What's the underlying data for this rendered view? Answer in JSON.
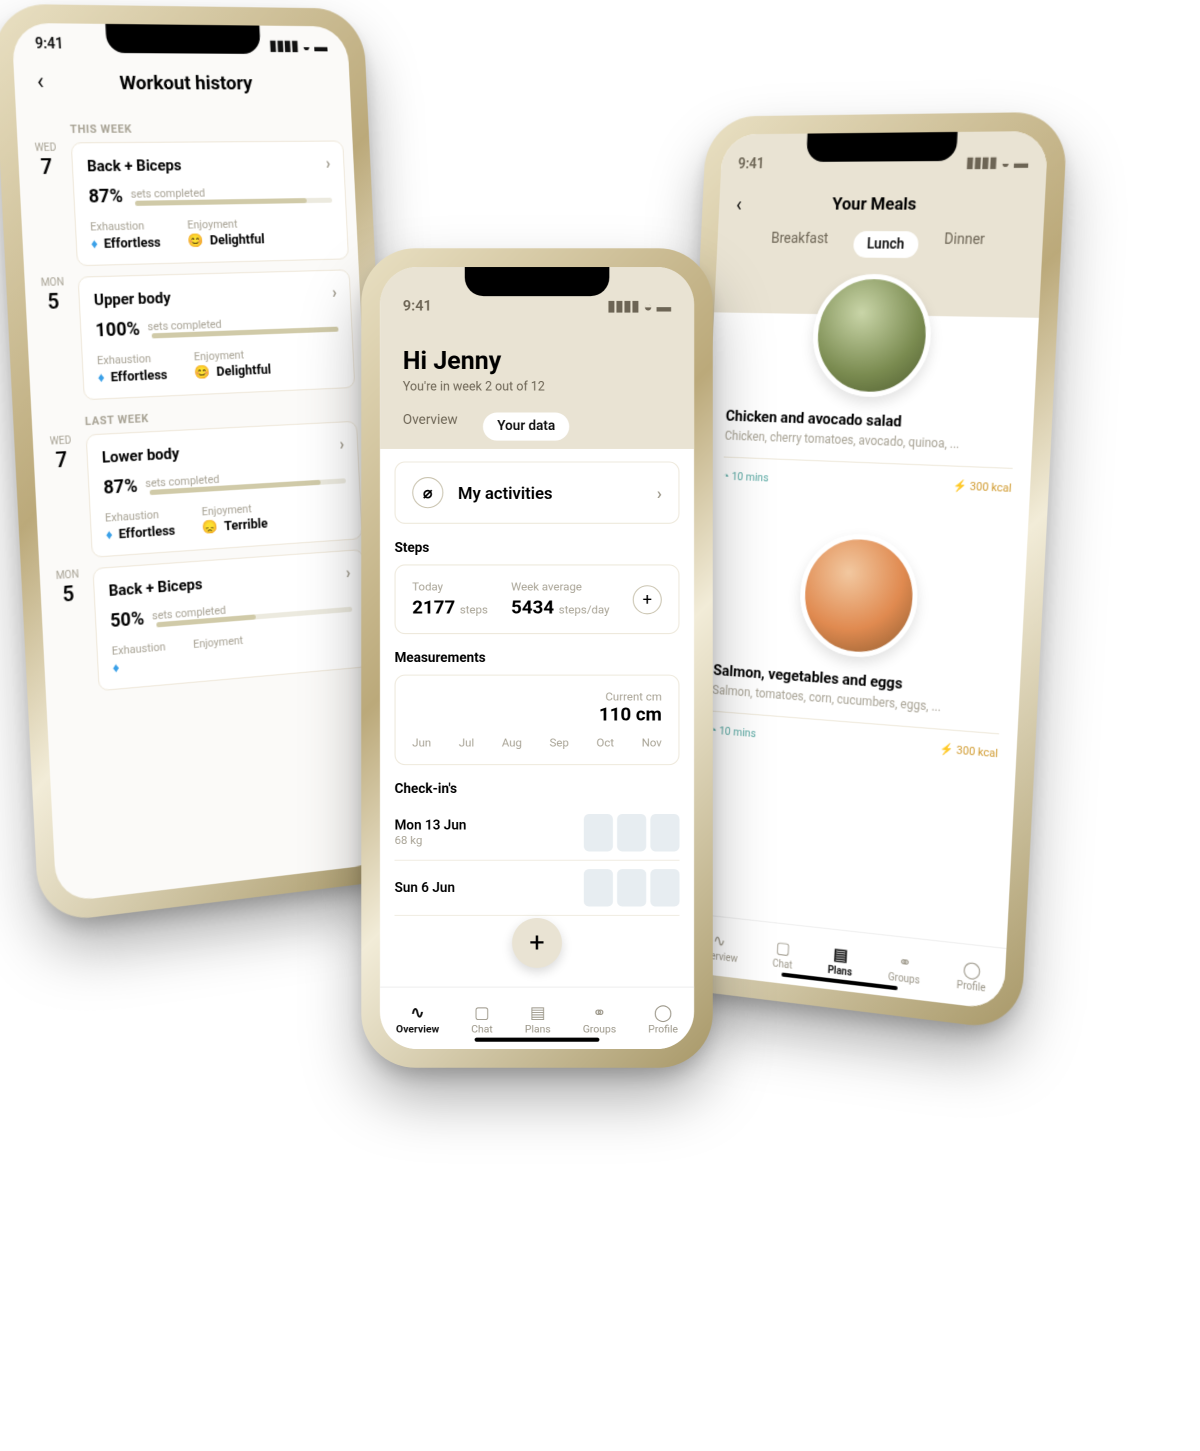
{
  "status": {
    "time": "9:41"
  },
  "phone1": {
    "title": "Workout history",
    "sections": [
      {
        "label": "THIS WEEK",
        "days": [
          {
            "dow": "WED",
            "dom": "7",
            "name": "Back + Biceps",
            "pct": "87%",
            "pctLabel": "sets completed",
            "exhaustionLabel": "Exhaustion",
            "exhaustion": "Effortless",
            "enjoymentLabel": "Enjoyment",
            "enjoyment": "Delightful",
            "enjoyEmoji": "😊",
            "barPct": 87
          },
          {
            "dow": "MON",
            "dom": "5",
            "name": "Upper body",
            "pct": "100%",
            "pctLabel": "sets completed",
            "exhaustionLabel": "Exhaustion",
            "exhaustion": "Effortless",
            "enjoymentLabel": "Enjoyment",
            "enjoyment": "Delightful",
            "enjoyEmoji": "😊",
            "barPct": 100
          }
        ]
      },
      {
        "label": "LAST WEEK",
        "days": [
          {
            "dow": "WED",
            "dom": "7",
            "name": "Lower body",
            "pct": "87%",
            "pctLabel": "sets completed",
            "exhaustionLabel": "Exhaustion",
            "exhaustion": "Effortless",
            "enjoymentLabel": "Enjoyment",
            "enjoyment": "Terrible",
            "enjoyEmoji": "😞",
            "barPct": 87
          },
          {
            "dow": "MON",
            "dom": "5",
            "name": "Back + Biceps",
            "pct": "50%",
            "pctLabel": "sets completed",
            "exhaustionLabel": "Exhaustion",
            "exhaustion": "",
            "enjoymentLabel": "Enjoyment",
            "enjoyment": "",
            "enjoyEmoji": "",
            "barPct": 50
          }
        ]
      }
    ]
  },
  "phone2": {
    "greeting": "Hi Jenny",
    "sub": "You're in week 2 out of 12",
    "tabs": {
      "t1": "Overview",
      "t2": "Your data"
    },
    "activities": "My activities",
    "stepsHeading": "Steps",
    "steps": {
      "todayLabel": "Today",
      "today": "2177",
      "todayUnit": "steps",
      "avgLabel": "Week average",
      "avg": "5434",
      "avgUnit": "steps/day"
    },
    "measHeading": "Measurements",
    "currentLabel": "Current cm",
    "currentVal": "110 cm",
    "months": [
      "Jun",
      "Jul",
      "Aug",
      "Sep",
      "Oct",
      "Nov"
    ],
    "checkinsHeading": "Check-in's",
    "checkins": [
      {
        "date": "Mon 13 Jun",
        "val": "68 kg"
      },
      {
        "date": "Sun 6 Jun",
        "val": ""
      }
    ],
    "nav": {
      "overview": "Overview",
      "chat": "Chat",
      "plans": "Plans",
      "groups": "Groups",
      "profile": "Profile"
    }
  },
  "phone3": {
    "title": "Your Meals",
    "tabs": {
      "b": "Breakfast",
      "l": "Lunch",
      "d": "Dinner"
    },
    "meals": [
      {
        "name": "Chicken and avocado salad",
        "ing": "Chicken, cherry tomatoes, avocado, quinoa, ...",
        "time": "10 mins",
        "kcal": "300 kcal"
      },
      {
        "name": "Salmon, vegetables and eggs",
        "ing": "Salmon, tomatoes, corn, cucumbers, eggs, ...",
        "time": "10 mins",
        "kcal": "300 kcal"
      }
    ],
    "nav": {
      "overview": "Overview",
      "chat": "Chat",
      "plans": "Plans",
      "groups": "Groups",
      "profile": "Profile"
    }
  }
}
